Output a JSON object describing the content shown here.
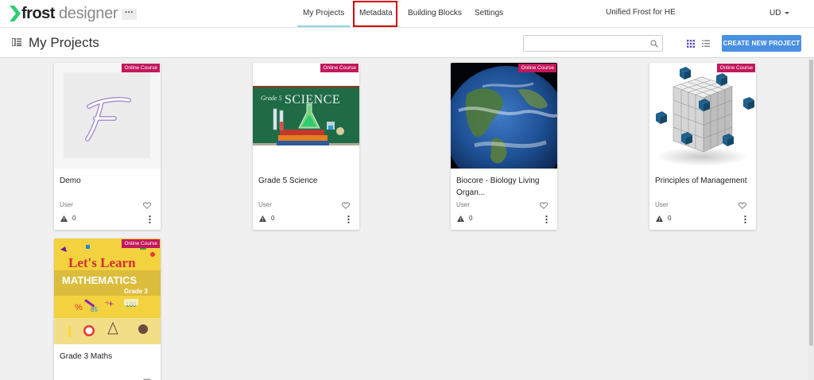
{
  "app": {
    "logo_bold": "frost",
    "logo_light": "designer",
    "more_label": "···",
    "accent": "#4a90e2",
    "badge_color": "#c2185b"
  },
  "nav": {
    "items": [
      {
        "label": "My Projects",
        "active": true
      },
      {
        "label": "Metadata",
        "active": false
      },
      {
        "label": "Building Blocks",
        "active": false
      },
      {
        "label": "Settings",
        "active": false
      }
    ],
    "org": "Unified Frost for HE",
    "user": "UD"
  },
  "header": {
    "title": "My Projects",
    "search_placeholder": "",
    "search_value": "",
    "create_label": "CREATE NEW PROJECT"
  },
  "projects": [
    {
      "title": "Demo",
      "badge": "Online Course",
      "owner": "User",
      "warnings": "0",
      "thumbnail": "frost-logo-placeholder"
    },
    {
      "title": "Grade 5 Science",
      "badge": "Online Course",
      "owner": "User",
      "warnings": "0",
      "thumbnail": "science-chalkboard",
      "thumb_text_small": "Grade 5",
      "thumb_text_big": "SCIENCE"
    },
    {
      "title": "Biocore - Biology Living Organ...",
      "badge": "Online Course",
      "owner": "User",
      "warnings": "0",
      "thumbnail": "earth"
    },
    {
      "title": "Principles of Management",
      "badge": "Online Course",
      "owner": "User",
      "warnings": "0",
      "thumbnail": "cube-blocks"
    },
    {
      "title": "Grade 3 Maths",
      "badge": "Online Course",
      "owner": "",
      "warnings": "",
      "thumbnail": "math-poster",
      "thumb_text_top": "Let's Learn",
      "thumb_text_mid": "MATHEMATICS",
      "thumb_text_sub": "Grade 3"
    }
  ]
}
